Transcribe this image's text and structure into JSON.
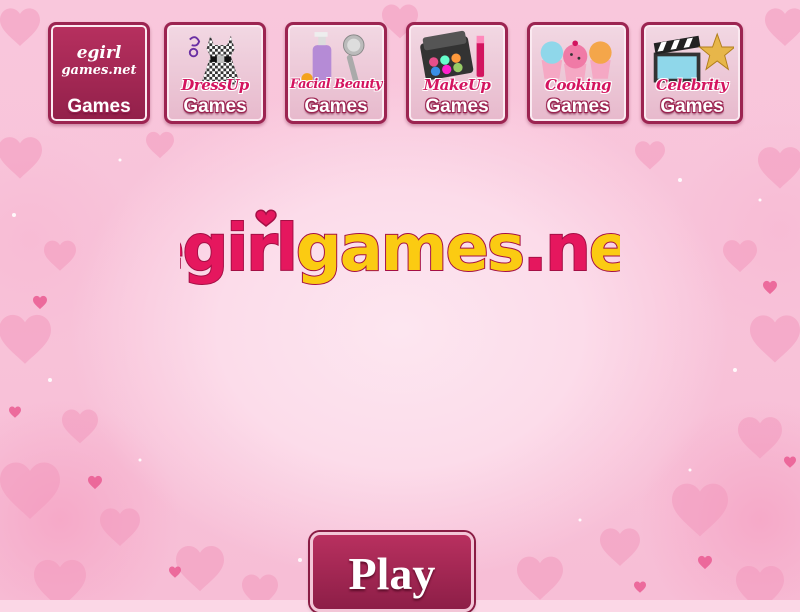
{
  "nav": {
    "tiles": [
      {
        "id": "home",
        "brand_line1": "egirl",
        "brand_line2": "games.net",
        "label": "Games"
      },
      {
        "id": "dressup",
        "script": "DressUp",
        "label": "Games"
      },
      {
        "id": "beauty",
        "script": "Facial Beauty",
        "label": "Games"
      },
      {
        "id": "makeup",
        "script": "MakeUp",
        "label": "Games"
      },
      {
        "id": "cooking",
        "script": "Cooking",
        "label": "Games"
      },
      {
        "id": "celebrity",
        "script": "Celebrity",
        "label": "Games"
      }
    ]
  },
  "logo": {
    "text": "egirlgames.net"
  },
  "play": {
    "label": "Play"
  },
  "colors": {
    "accent": "#9c2451",
    "logo_pink": "#e5175e",
    "logo_yellow": "#fbcb12",
    "background": "#f9c7dc"
  }
}
